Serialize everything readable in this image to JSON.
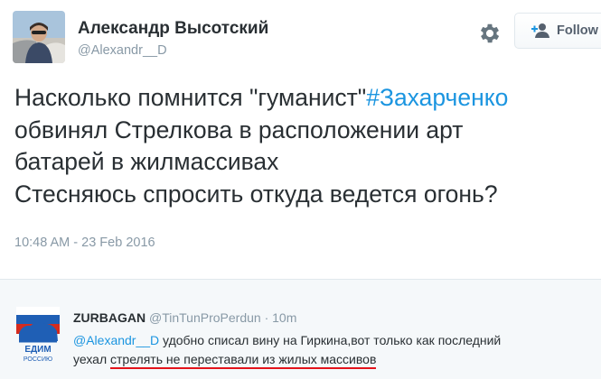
{
  "author": {
    "name": "Александр Высотский",
    "handle": "@Alexandr__D"
  },
  "follow_button": {
    "label": "Follow"
  },
  "tweet": {
    "line1_text": "Насколько помнится \"гуманист\"",
    "line1_hashtag": "#Захарченко",
    "line2": "обвинял Стрелкова в расположении арт",
    "line3": "батарей в жилмассивах",
    "line4": "Стесняюсь спросить откуда ведется огонь?",
    "timestamp": "10:48 AM - 23 Feb 2016"
  },
  "reply": {
    "name": "ZURBAGAN",
    "handle": "@TinTunProPerdun",
    "separator": "·",
    "time": "10m",
    "mention": "@Alexandr__D",
    "line1_rest": " удобно списал вину на Гиркина,вот только как последний",
    "line2_start": "уехал ",
    "line2_underlined": "стрелять не переставали из жилых массивов",
    "logo_text_top": "ЕДИМ",
    "logo_text_bottom": "РОССИЮ"
  },
  "icons": [
    "gear-icon",
    "follow-person-icon",
    "bear-logo"
  ],
  "colors": {
    "link": "#1b95e0",
    "muted": "#8899a6",
    "text": "#292f33",
    "underline": "#e3131b",
    "reply_bg": "#f5f8fa"
  }
}
